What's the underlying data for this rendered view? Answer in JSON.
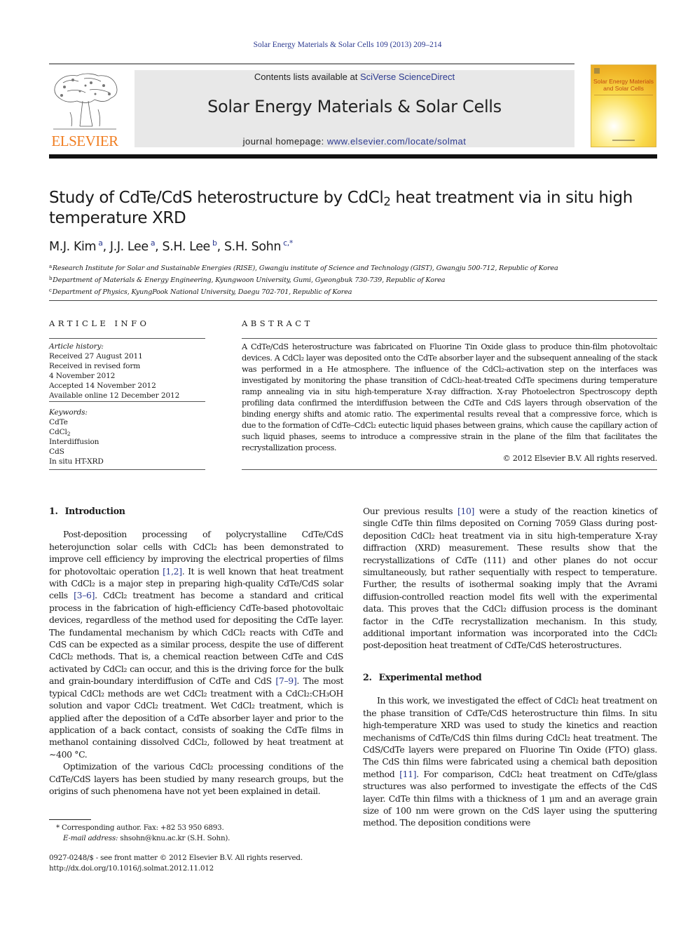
{
  "running_header": "Solar Energy Materials & Solar Cells 109 (2013) 209–214",
  "masthead": {
    "publisher_logo_text": "ELSEVIER",
    "contents_prefix": "Contents lists available at ",
    "contents_link": "SciVerse ScienceDirect",
    "journal_name": "Solar Energy Materials & Solar Cells",
    "homepage_prefix": "journal homepage: ",
    "homepage_link": "www.elsevier.com/locate/solmat",
    "cover_title": "Solar Energy Materials and Solar Cells"
  },
  "article": {
    "title_part1": "Study of CdTe/CdS heterostructure by CdCl",
    "title_sub": "2",
    "title_part2": " heat treatment via in situ high temperature XRD",
    "authors": [
      {
        "name": "M.J. Kim",
        "sup": "a"
      },
      {
        "name": "J.J. Lee",
        "sup": "a"
      },
      {
        "name": "S.H. Lee",
        "sup": "b"
      },
      {
        "name": "S.H. Sohn",
        "sup": "c,*"
      }
    ],
    "affiliations": [
      {
        "key": "a",
        "text": "Research Institute for Solar and Sustainable Energies (RISE), Gwangju institute of Science and Technology (GIST), Gwangju 500-712, Republic of Korea"
      },
      {
        "key": "b",
        "text": "Department of Materials & Energy Engineering, Kyungwoon University, Gumi, Gyeongbuk 730-739, Republic of Korea"
      },
      {
        "key": "c",
        "text": "Department of Physics, KyungPook National University, Daegu 702-701, Republic of Korea"
      }
    ]
  },
  "article_info": {
    "label": "ARTICLE INFO",
    "history_head": "Article history:",
    "history": [
      "Received 27 August 2011",
      "Received in revised form",
      "4 November 2012",
      "Accepted 14 November 2012",
      "Available online 12 December 2012"
    ],
    "keywords_head": "Keywords:",
    "keywords": [
      "CdTe",
      "CdCl2",
      "Interdiffusion",
      "CdS",
      "In situ HT-XRD"
    ]
  },
  "abstract": {
    "label": "ABSTRACT",
    "text": "A CdTe/CdS heterostructure was fabricated on Fluorine Tin Oxide glass to produce thin-film photovoltaic devices. A CdCl₂ layer was deposited onto the CdTe absorber layer and the subsequent annealing of the stack was performed in a He atmosphere. The influence of the CdCl₂-activation step on the interfaces was investigated by monitoring the phase transition of CdCl₂-heat-treated CdTe specimens during temperature ramp annealing via in situ high-temperature X-ray diffraction. X-ray Photoelectron Spectroscopy depth profiling data confirmed the interdiffusion between the CdTe and CdS layers through observation of the binding energy shifts and atomic ratio. The experimental results reveal that a compressive force, which is due to the formation of CdTe–CdCl₂ eutectic liquid phases between grains, which cause the capillary action of such liquid phases, seems to introduce a compressive strain in the plane of the film that facilitates the recrystallization process.",
    "copyright": "© 2012 Elsevier B.V. All rights reserved."
  },
  "sections": {
    "intro": {
      "number": "1.",
      "title": "Introduction",
      "p1_a": "Post-deposition processing of polycrystalline CdTe/CdS heterojunction solar cells with CdCl₂ has been demonstrated to improve cell efficiency by improving the electrical properties of films for photovoltaic operation ",
      "p1_ref1": "[1,2]",
      "p1_b": ". It is well known that heat treatment with CdCl₂ is a major step in preparing high-quality CdTe/CdS solar cells ",
      "p1_ref2": "[3–6]",
      "p1_c": ". CdCl₂ treatment has become a standard and critical process in the fabrication of high-efficiency CdTe-based photovoltaic devices, regardless of the method used for depositing the CdTe layer. The fundamental mechanism by which CdCl₂ reacts with CdTe and CdS can be expected as a similar process, despite the use of different CdCl₂ methods. That is, a chemical reaction between CdTe and CdS activated by CdCl₂ can occur, and this is the driving force for the bulk and grain-boundary interdiffusion of CdTe and CdS ",
      "p1_ref3": "[7–9]",
      "p1_d": ". The most typical CdCl₂ methods are wet CdCl₂ treatment with a CdCl₂:CH₃OH solution and vapor CdCl₂ treatment. Wet CdCl₂ treatment, which is applied after the deposition of a CdTe absorber layer and prior to the application of a back contact, consists of soaking the CdTe films in methanol containing dissolved CdCl₂, followed by heat treatment at ∼400 °C.",
      "p2": "Optimization of the various CdCl₂ processing conditions of the CdTe/CdS layers has been studied by many research groups, but the origins of such phenomena have not yet been explained in detail.",
      "p3_a": "Our previous results ",
      "p3_ref": "[10]",
      "p3_b": " were a study of the reaction kinetics of single CdTe thin films deposited on Corning 7059 Glass during post-deposition CdCl₂ heat treatment via in situ high-temperature X-ray diffraction (XRD) measurement. These results show that the recrystallizations of CdTe (111) and other planes do not occur simultaneously, but rather sequentially with respect to temperature. Further, the results of isothermal soaking imply that the Avrami diffusion-controlled reaction model fits well with the experimental data. This proves that the CdCl₂ diffusion process is the dominant factor in the CdTe recrystallization mechanism. In this study, additional important information was incorporated into the CdCl₂ post-deposition heat treatment of CdTe/CdS heterostructures."
    },
    "method": {
      "number": "2.",
      "title": "Experimental method",
      "p1_a": "In this work, we investigated the effect of CdCl₂ heat treatment on the phase transition of CdTe/CdS heterostructure thin films. In situ high-temperature XRD was used to study the kinetics and reaction mechanisms of CdTe/CdS thin films during CdCl₂ heat treatment. The CdS/CdTe layers were prepared on Fluorine Tin Oxide (FTO) glass. The CdS thin films were fabricated using a chemical bath deposition method ",
      "p1_ref": "[11]",
      "p1_b": ". For comparison, CdCl₂ heat treatment on CdTe/glass structures was also performed to investigate the effects of the CdS layer. CdTe thin films with a thickness of 1 μm and an average grain size of 100 nm were grown on the CdS layer using the sputtering method. The deposition conditions were"
    }
  },
  "footnotes": {
    "corresponding": "* Corresponding author. Fax: +82 53 950 6893.",
    "email_label": "E-mail address:",
    "email_value": " shsohn@knu.ac.kr (S.H. Sohn).",
    "front_matter": "0927-0248/$ - see front matter © 2012 Elsevier B.V. All rights reserved.",
    "doi": "http://dx.doi.org/10.1016/j.solmat.2012.11.012"
  },
  "colors": {
    "link": "#2b3990",
    "elsevier_orange": "#f07e22",
    "masthead_bg": "#e8e8e8"
  }
}
